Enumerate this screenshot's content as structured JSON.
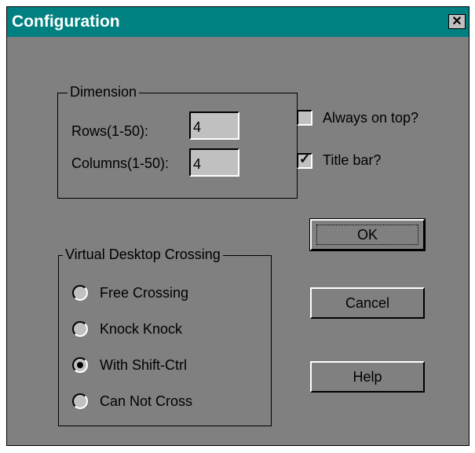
{
  "window": {
    "title": "Configuration",
    "close_glyph": "✕"
  },
  "dimension": {
    "legend": "Dimension",
    "rows_label": "Rows(1-50):",
    "rows_value": "4",
    "columns_label": "Columns(1-50):",
    "columns_value": "4"
  },
  "options": {
    "always_on_top_label": "Always on top?",
    "always_on_top_checked": false,
    "title_bar_label": "Title bar?",
    "title_bar_checked": true,
    "check_glyph": "✓"
  },
  "crossing": {
    "legend": "Virtual Desktop Crossing",
    "options": [
      {
        "label": "Free Crossing",
        "selected": false
      },
      {
        "label": "Knock Knock",
        "selected": false
      },
      {
        "label": "With Shift-Ctrl",
        "selected": true
      },
      {
        "label": "Can Not Cross",
        "selected": false
      }
    ]
  },
  "buttons": {
    "ok_label": "OK",
    "cancel_label": "Cancel",
    "help_label": "Help"
  }
}
